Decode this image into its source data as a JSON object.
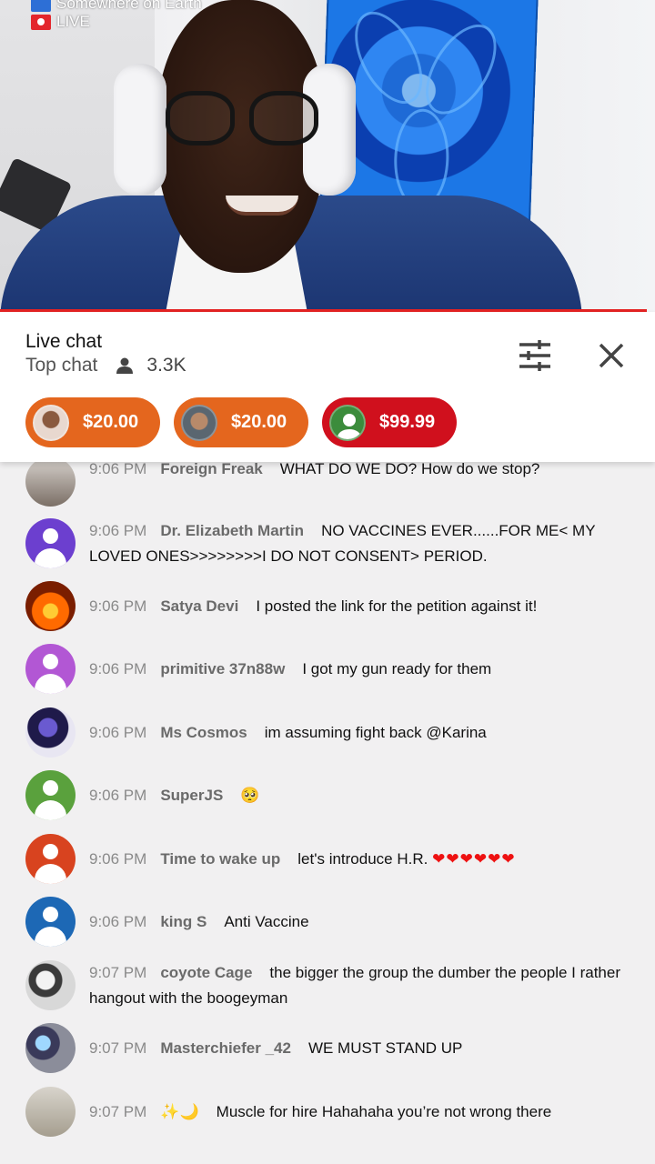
{
  "video": {
    "location_label": "Somewhere on Earth",
    "live_label": "LIVE",
    "progress_fraction": 0.988
  },
  "chat": {
    "title": "Live chat",
    "mode": "Top chat",
    "viewers": "3.3K",
    "filter_icon": "tune-icon",
    "close_icon": "close-icon"
  },
  "super_chats": [
    {
      "amount": "$20.00",
      "color": "#e4661e"
    },
    {
      "amount": "$20.00",
      "color": "#e4661e"
    },
    {
      "amount": "$99.99",
      "color": "#d0101d"
    }
  ],
  "messages": [
    {
      "time": "9:06 PM",
      "author": "Foreign Freak",
      "text": "WHAT DO WE DO? How do we stop?"
    },
    {
      "time": "9:06 PM",
      "author": "Dr. Elizabeth Martin",
      "text": "NO VACCINES EVER......FOR ME< MY LOVED ONES>>>>>>>>I DO NOT CONSENT> PERIOD."
    },
    {
      "time": "9:06 PM",
      "author": "Satya Devi",
      "text": "I posted the link for the petition against it!"
    },
    {
      "time": "9:06 PM",
      "author": "primitive 37n88w",
      "text": "I got my gun ready for them"
    },
    {
      "time": "9:06 PM",
      "author": "Ms Cosmos",
      "text": "im assuming fight back @Karina"
    },
    {
      "time": "9:06 PM",
      "author": "SuperJS",
      "text": "🥺"
    },
    {
      "time": "9:06 PM",
      "author": "Time to wake up",
      "text": "let's introduce H.R.",
      "hearts": "❤❤❤❤❤❤"
    },
    {
      "time": "9:06 PM",
      "author": "king S",
      "text": "Anti Vaccine"
    },
    {
      "time": "9:07 PM",
      "author": "coyote Cage",
      "text": "the bigger the group the dumber the people I rather hangout with the boogeyman"
    },
    {
      "time": "9:07 PM",
      "author": "Masterchiefer _42",
      "text": "WE MUST STAND UP"
    },
    {
      "time": "9:07 PM",
      "author": "✨🌙",
      "text": "Muscle for hire Hahahaha you’re not wrong there"
    }
  ]
}
